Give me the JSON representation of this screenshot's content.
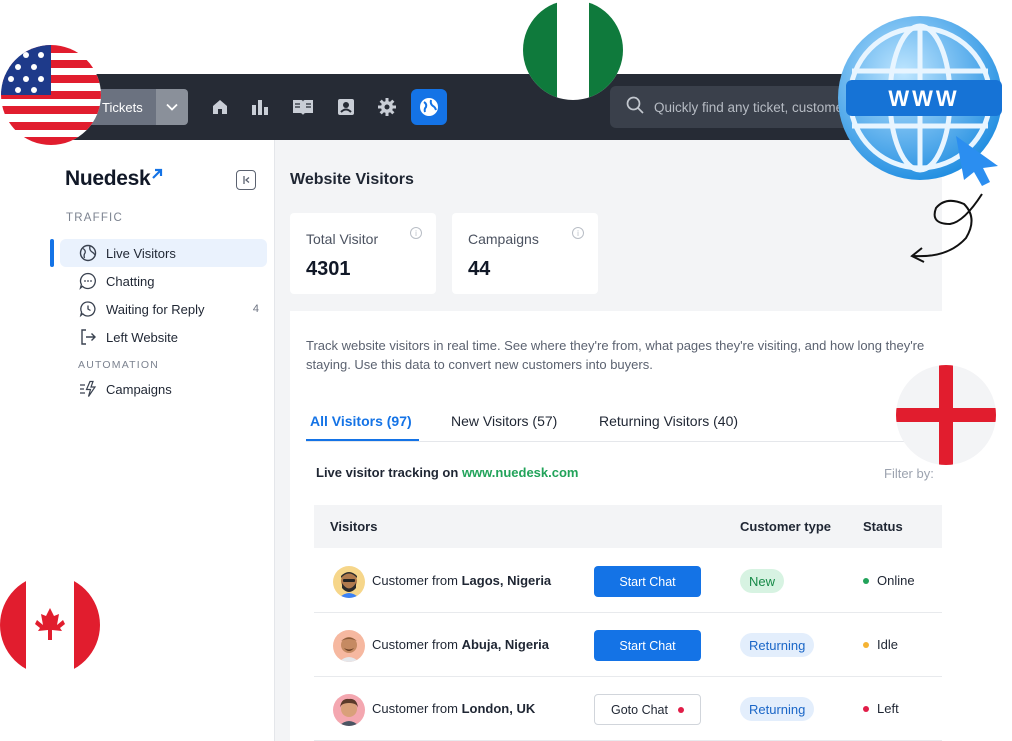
{
  "topbar": {
    "tickets_label": "Tickets",
    "search_placeholder": "Quickly find any ticket, customer"
  },
  "sidebar": {
    "brand": "Nuedesk",
    "traffic_label": "TRAFFIC",
    "automation_label": "AUTOMATION",
    "items": [
      {
        "label": "Live Visitors",
        "icon": "globe-icon"
      },
      {
        "label": "Chatting",
        "icon": "chat-icon"
      },
      {
        "label": "Waiting for Reply",
        "icon": "clock-chat-icon",
        "count": "4"
      },
      {
        "label": "Left Website",
        "icon": "exit-icon"
      },
      {
        "label": "Campaigns",
        "icon": "campaign-icon"
      }
    ]
  },
  "main": {
    "title": "Website Visitors",
    "stats": [
      {
        "label": "Total Visitor",
        "value": "4301"
      },
      {
        "label": "Campaigns",
        "value": "44"
      }
    ],
    "description": "Track website visitors in real time. See where they're from, what pages they're visiting, and how long they're staying. Use this data to convert new customers into buyers.",
    "tabs": [
      "All Visitors (97)",
      "New Visitors (57)",
      "Returning Visitors (40)"
    ],
    "tracking_prefix": "Live visitor tracking on ",
    "tracking_url": "www.nuedesk.com",
    "filter_label": "Filter by:",
    "table": {
      "headers": [
        "Visitors",
        "Customer type",
        "Status"
      ],
      "rows": [
        {
          "prefix": "Customer from ",
          "location": "Lagos, Nigeria",
          "action": "Start Chat",
          "type": "New",
          "status": "Online"
        },
        {
          "prefix": "Customer from ",
          "location": "Abuja, Nigeria",
          "action": "Start Chat",
          "type": "Returning",
          "status": "Idle"
        },
        {
          "prefix": "Customer from ",
          "location": "London, UK",
          "action": "Goto Chat",
          "type": "Returning",
          "status": "Left"
        }
      ]
    }
  },
  "decor": {
    "www_badge": "WWW"
  },
  "colors": {
    "accent": "#1473e6",
    "topbar": "#262b35",
    "online": "#22a35a",
    "idle": "#f5b333",
    "left": "#e11d48"
  }
}
